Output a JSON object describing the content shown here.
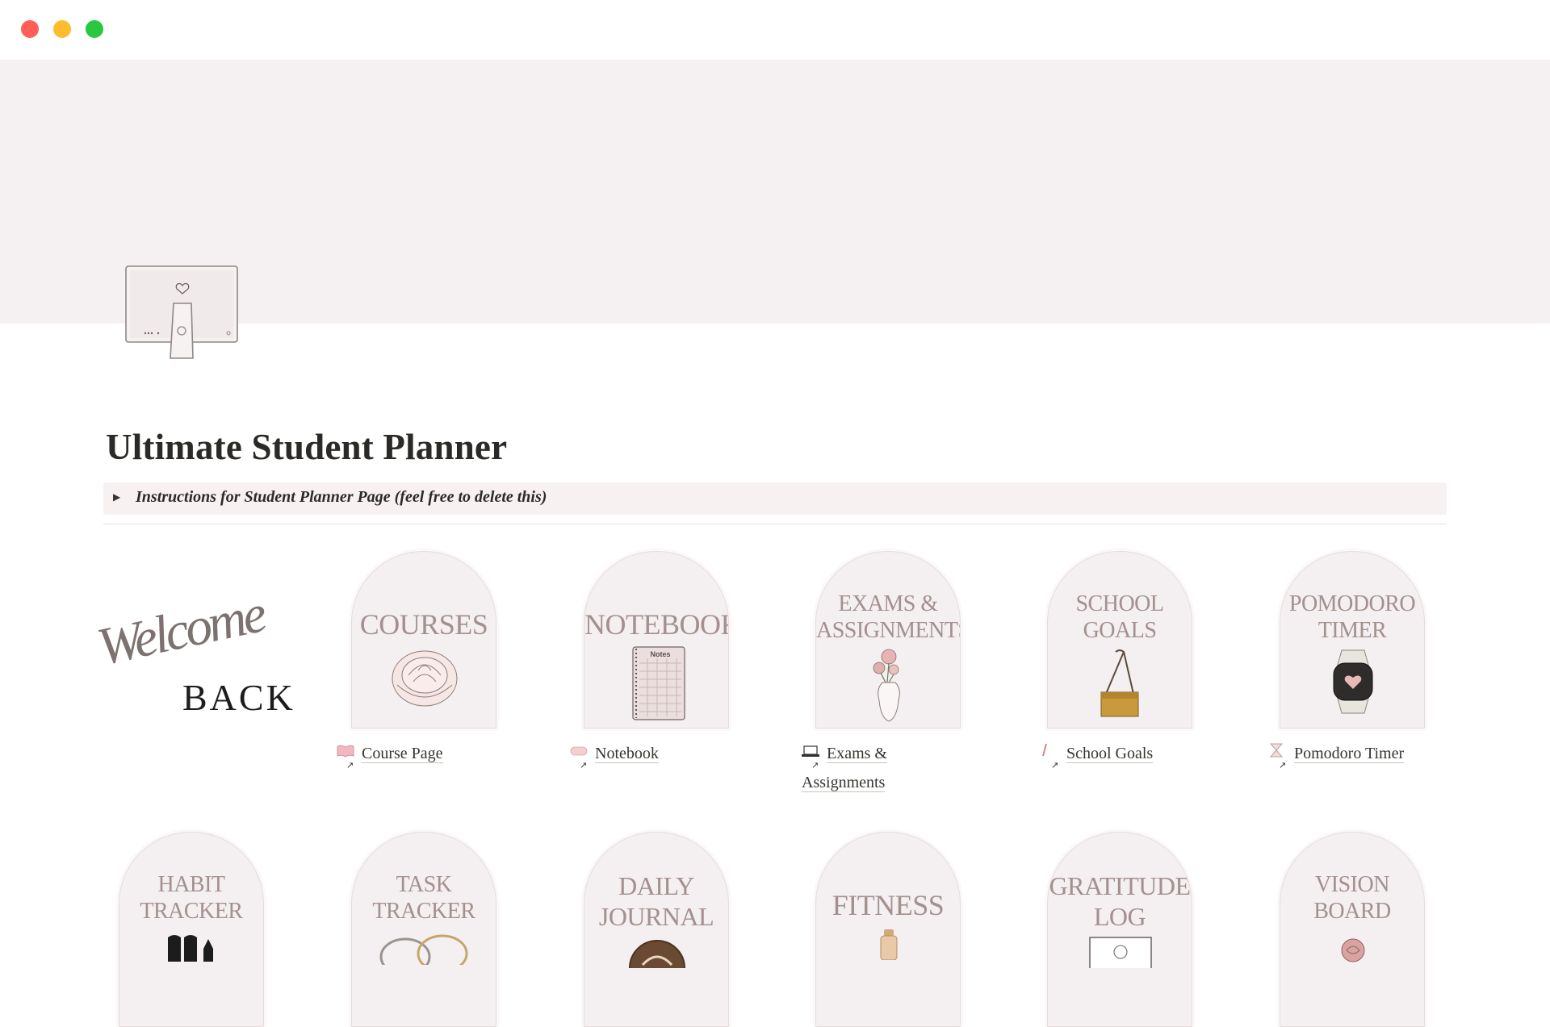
{
  "window": {
    "traffic_lights": {
      "close_color": "#ff5f57",
      "minimize_color": "#febc2e",
      "maximize_color": "#28c840"
    }
  },
  "page": {
    "title": "Ultimate Student Planner",
    "cover_color": "#f5f0f1",
    "icon": "imac-heart-icon"
  },
  "callout": {
    "text": "Instructions for Student Planner Page (feel free to delete this)"
  },
  "welcome": {
    "script": "Welcome",
    "block": "BACK"
  },
  "row1": [
    {
      "label_lines": [
        "COURSES"
      ],
      "link": "Course Page",
      "link_icon": "book-icon",
      "illustration": "peony-icon"
    },
    {
      "label_lines": [
        "NOTEBOOK"
      ],
      "link": "Notebook",
      "link_icon": "eraser-icon",
      "illustration": "notebook-icon",
      "notebook_text": "Notes"
    },
    {
      "label_lines": [
        "EXAMS &",
        "ASSIGNMENTS"
      ],
      "link_lines": [
        "Exams &",
        "Assignments"
      ],
      "link_icon": "laptop-icon",
      "illustration": "flower-vase-icon"
    },
    {
      "label_lines": [
        "SCHOOL",
        "GOALS"
      ],
      "link": "School Goals",
      "link_icon": "pencil-icon",
      "illustration": "binder-clip-icon"
    },
    {
      "label_lines": [
        "POMODORO",
        "TIMER"
      ],
      "link": "Pomodoro Timer",
      "link_icon": "hourglass-icon",
      "illustration": "smartwatch-icon"
    }
  ],
  "row2": [
    {
      "label_lines": [
        "HABIT",
        "TRACKER"
      ],
      "illustration": "shoes-icon"
    },
    {
      "label_lines": [
        "TASK",
        "TRACKER"
      ],
      "illustration": "rings-icon"
    },
    {
      "label_lines": [
        "DAILY",
        "JOURNAL"
      ],
      "illustration": "coffee-icon"
    },
    {
      "label_lines": [
        "FITNESS"
      ],
      "illustration": "water-bottle-icon"
    },
    {
      "label_lines": [
        "GRATITUDE",
        "LOG"
      ],
      "illustration": "photo-frame-icon"
    },
    {
      "label_lines": [
        "VISION",
        "BOARD"
      ],
      "illustration": "rose-icon"
    }
  ]
}
